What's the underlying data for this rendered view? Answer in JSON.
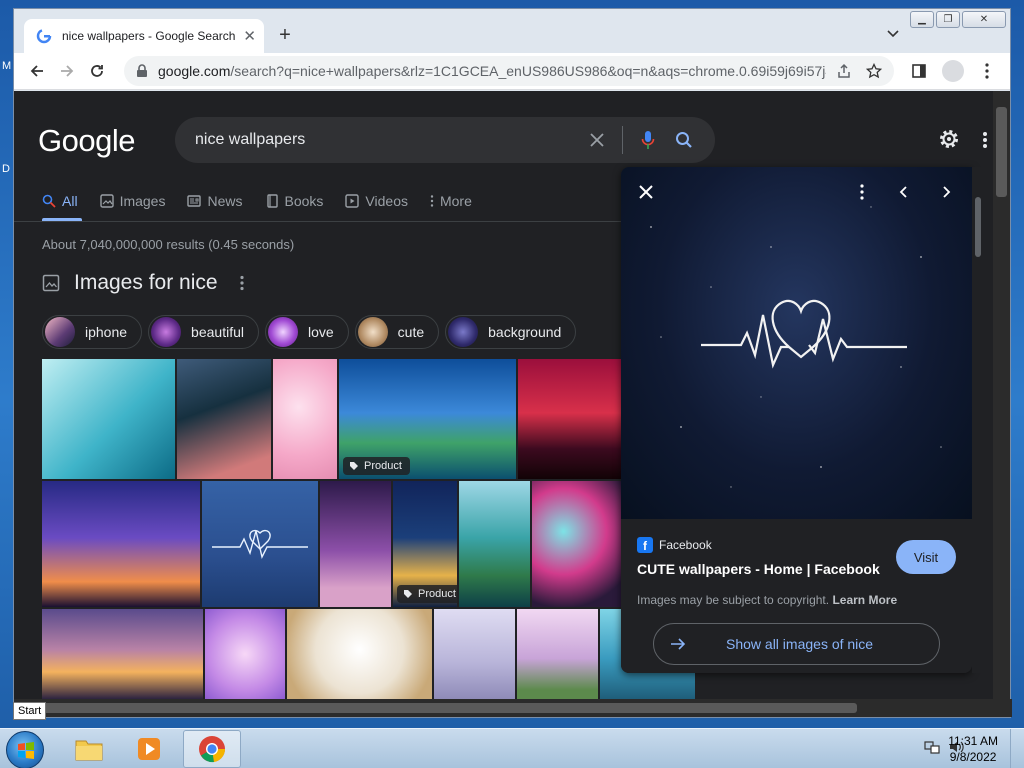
{
  "desktop": {
    "edge_letters": [
      "M",
      "D"
    ]
  },
  "browser": {
    "tab_title": "nice wallpapers - Google Search",
    "url_host": "google.com",
    "url_rest": "/search?q=nice+wallpapers&rlz=1C1GCEA_enUS986US986&oq=n&aqs=chrome.0.69i59j69i57j4..."
  },
  "google": {
    "logo": "Google",
    "query": "nice wallpapers",
    "tabs": [
      {
        "label": "All",
        "icon": "search-icon",
        "active": true
      },
      {
        "label": "Images",
        "icon": "image-icon"
      },
      {
        "label": "News",
        "icon": "news-icon"
      },
      {
        "label": "Books",
        "icon": "book-icon"
      },
      {
        "label": "Videos",
        "icon": "video-icon"
      },
      {
        "label": "More",
        "icon": "more-vert-icon"
      }
    ],
    "result_stats": "About 7,040,000,000 results (0.45 seconds)",
    "images_heading": "Images for nice",
    "chips": [
      "iphone",
      "beautiful",
      "love",
      "cute",
      "background"
    ],
    "product_badge": "Product"
  },
  "preview": {
    "source": "Facebook",
    "title": "CUTE wallpapers - Home | Facebook",
    "visit": "Visit",
    "copyright": "Images may be subject to copyright.",
    "learn_more": "Learn More",
    "show_all": "Show all images of nice"
  },
  "taskbar": {
    "start_tooltip": "Start",
    "time": "11:31 AM",
    "date": "9/8/2022"
  },
  "colors": {
    "page_bg": "#202124",
    "link_blue": "#8ab4f8",
    "search_bg": "#303134"
  }
}
